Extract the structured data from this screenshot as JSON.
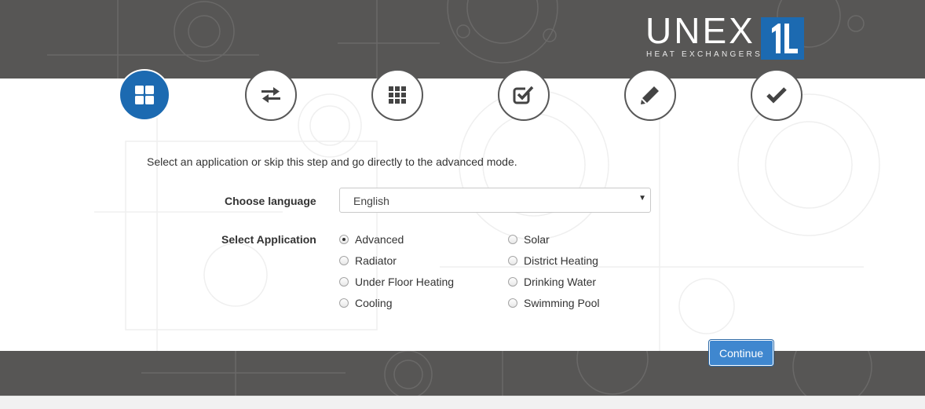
{
  "logo": {
    "wordmark": "UNEX",
    "tagline": "HEAT EXCHANGERS",
    "mark_text": "1L"
  },
  "steps": [
    {
      "icon": "grid-four-icon",
      "active": true
    },
    {
      "icon": "swap-arrows-icon",
      "active": false
    },
    {
      "icon": "grid-nine-icon",
      "active": false
    },
    {
      "icon": "checkbox-icon",
      "active": false
    },
    {
      "icon": "pencil-icon",
      "active": false
    },
    {
      "icon": "checkmark-icon",
      "active": false
    }
  ],
  "form": {
    "intro": "Select an application or skip this step and go directly to the advanced mode.",
    "language_label": "Choose language",
    "language_value": "English",
    "application_label": "Select Application",
    "applications_left": [
      "Advanced",
      "Radiator",
      "Under Floor Heating",
      "Cooling"
    ],
    "applications_right": [
      "Solar",
      "District Heating",
      "Drinking Water",
      "Swimming Pool"
    ],
    "selected_application": "Advanced"
  },
  "continue_label": "Continue",
  "colors": {
    "accent": "#1c6ab1",
    "band": "#575655",
    "button": "#3f87cf"
  }
}
